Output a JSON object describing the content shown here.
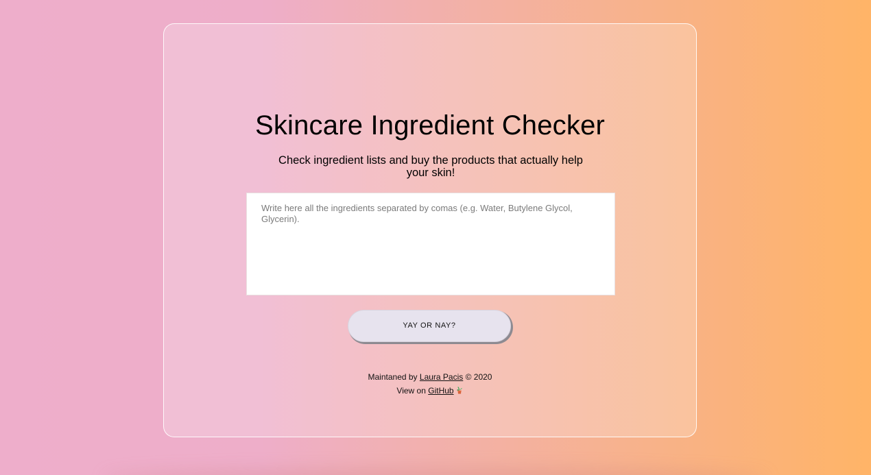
{
  "header": {
    "title": "Skincare Ingredient Checker",
    "subtitle": "Check ingredient lists and buy the products that actually help your skin!"
  },
  "form": {
    "ingredients_placeholder": "Write here all the ingredients separated by comas (e.g. Water, Butylene Glycol, Glycerin).",
    "ingredients_value": "",
    "submit_label": "YAY OR NAY?"
  },
  "footer": {
    "maintained_prefix": "Maintaned by",
    "author_link": "Laura Pacis",
    "copyright": "© 2020",
    "view_prefix": "View on",
    "github_link": "GitHub",
    "plant_icon": "potted-plant-icon"
  },
  "colors": {
    "gradient_start": "#eeaecb",
    "gradient_end": "#ffb467",
    "button_bg": "#e7e3ee"
  }
}
